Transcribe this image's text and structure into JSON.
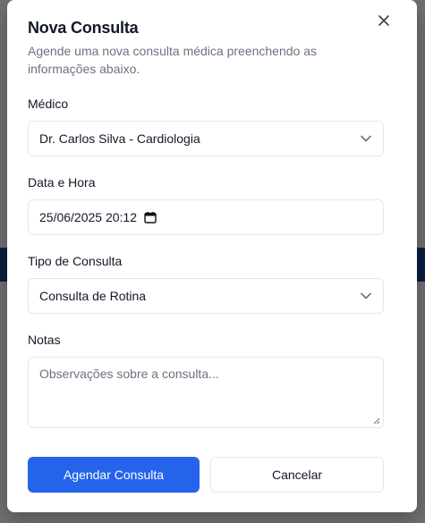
{
  "dialog": {
    "title": "Nova Consulta",
    "subtitle": "Agende uma nova consulta médica preenchendo as informações abaixo.",
    "close_icon": "close-icon"
  },
  "fields": {
    "doctor": {
      "label": "Médico",
      "value": "Dr. Carlos Silva - Cardiologia",
      "icon": "chevron-down-icon"
    },
    "datetime": {
      "label": "Data e Hora",
      "value": "25/06/2025 20:12",
      "icon": "calendar-icon"
    },
    "type": {
      "label": "Tipo de Consulta",
      "value": "Consulta de Rotina",
      "icon": "chevron-down-icon"
    },
    "notes": {
      "label": "Notas",
      "value": "",
      "placeholder": "Observações sobre a consulta..."
    }
  },
  "actions": {
    "submit_label": "Agendar Consulta",
    "cancel_label": "Cancelar"
  },
  "colors": {
    "primary": "#2563eb",
    "backdrop": "#6f7072",
    "background_band": "#0c1e3f"
  }
}
